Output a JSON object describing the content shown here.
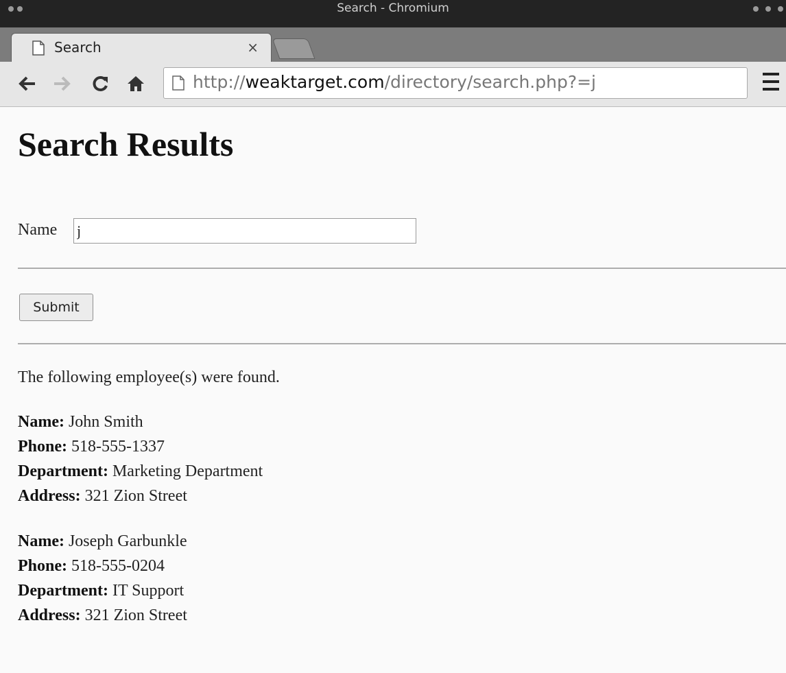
{
  "window": {
    "title": "Search - Chromium"
  },
  "tab": {
    "label": "Search",
    "close": "×"
  },
  "toolbar": {
    "url_scheme": "http://",
    "url_host": "weaktarget.com",
    "url_path": "/directory/search.php?=j"
  },
  "icons": {
    "back": "back-arrow-icon",
    "forward": "forward-arrow-icon",
    "reload": "reload-icon",
    "home": "home-icon",
    "menu": "hamburger-menu-icon",
    "page": "page-icon"
  },
  "page": {
    "heading": "Search Results",
    "name_label": "Name",
    "name_value": "j",
    "submit_label": "Submit",
    "found_message": "The following employee(s) were found.",
    "field_labels": {
      "name": "Name:",
      "phone": "Phone:",
      "department": "Department:",
      "address": "Address:"
    },
    "employees": [
      {
        "name": "John Smith",
        "phone": "518-555-1337",
        "department": "Marketing Department",
        "address": "321 Zion Street"
      },
      {
        "name": "Joseph Garbunkle",
        "phone": "518-555-0204",
        "department": "IT Support",
        "address": "321 Zion Street"
      }
    ]
  },
  "colors": {
    "titlebar": "#232323",
    "tabstrip": "#7c7c7c",
    "toolbar": "#e6e6e6",
    "page_bg": "#fafafa"
  }
}
